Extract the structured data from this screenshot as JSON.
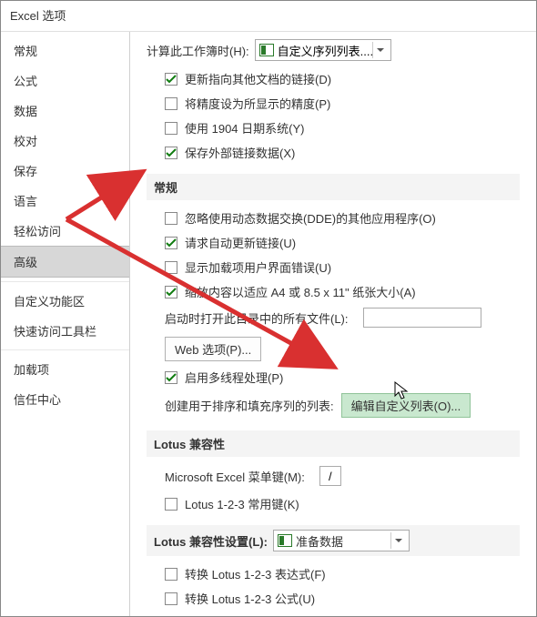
{
  "window": {
    "title": "Excel 选项"
  },
  "sidebar": {
    "items": [
      {
        "label": "常规"
      },
      {
        "label": "公式"
      },
      {
        "label": "数据"
      },
      {
        "label": "校对"
      },
      {
        "label": "保存"
      },
      {
        "label": "语言"
      },
      {
        "label": "轻松访问"
      },
      {
        "label": "高级",
        "selected": true
      },
      {
        "label": "自定义功能区"
      },
      {
        "label": "快速访问工具栏"
      },
      {
        "label": "加载项"
      },
      {
        "label": "信任中心"
      }
    ]
  },
  "top_cut": {
    "label": "计算此工作簿时(H):",
    "dropdown_value": "自定义序列列表...."
  },
  "calc_group": [
    {
      "checked": true,
      "label": "更新指向其他文档的链接(D)"
    },
    {
      "checked": false,
      "label": "将精度设为所显示的精度(P)"
    },
    {
      "checked": false,
      "label": "使用 1904 日期系统(Y)"
    },
    {
      "checked": true,
      "label": "保存外部链接数据(X)"
    }
  ],
  "section_general": {
    "title": "常规"
  },
  "general_group": [
    {
      "checked": false,
      "label": "忽略使用动态数据交换(DDE)的其他应用程序(O)"
    },
    {
      "checked": true,
      "label": "请求自动更新链接(U)"
    },
    {
      "checked": false,
      "label": "显示加载项用户界面错误(U)"
    },
    {
      "checked": true,
      "label": "缩放内容以适应 A4 或 8.5 x 11\" 纸张大小(A)"
    }
  ],
  "startup": {
    "label": "启动时打开此目录中的所有文件(L):",
    "value": ""
  },
  "web_btn": {
    "label": "Web 选项(P)..."
  },
  "multithread": {
    "checked": true,
    "label": "启用多线程处理(P)"
  },
  "custom_list": {
    "prefix": "创建用于排序和填充序列的列表:",
    "button": "编辑自定义列表(O)..."
  },
  "section_lotus": {
    "title": "Lotus 兼容性"
  },
  "lotus_menu": {
    "label": "Microsoft Excel 菜单键(M):",
    "value": "/"
  },
  "lotus_nav": {
    "checked": false,
    "label": "Lotus 1-2-3 常用键(K)"
  },
  "section_lotus_settings": {
    "title": "Lotus 兼容性设置(L):",
    "dropdown_value": "准备数据"
  },
  "lotus_settings_group": [
    {
      "checked": false,
      "label": "转换 Lotus 1-2-3 表达式(F)"
    },
    {
      "checked": false,
      "label": "转换 Lotus 1-2-3 公式(U)"
    }
  ]
}
